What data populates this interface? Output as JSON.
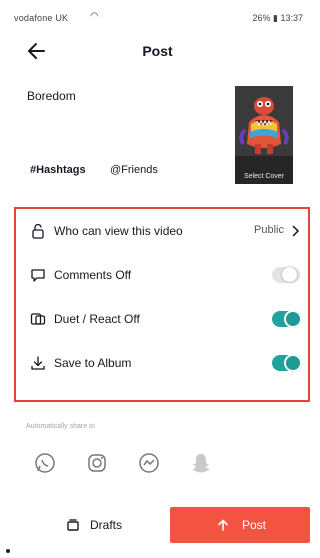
{
  "status_bar": {
    "carrier": "vodafone UK",
    "time": "13:37",
    "battery": "26%"
  },
  "header": {
    "title": "Post"
  },
  "post": {
    "caption": "Boredom",
    "cover_label": "Select Cover",
    "hashtags_label": "#Hashtags",
    "friends_label": "@Friends"
  },
  "settings": {
    "who_can_view_label": "Who can view this video",
    "who_can_view_value": "Public",
    "comments_label": "Comments Off",
    "comments_on": false,
    "duet_label": "Duet / React Off",
    "duet_on": true,
    "save_label": "Save to Album",
    "save_on": true
  },
  "share": {
    "label": "Automatically share to",
    "targets": [
      "whatsapp-icon",
      "instagram-icon",
      "facebook-messenger-icon",
      "snapchat-icon"
    ]
  },
  "actions": {
    "drafts_label": "Drafts",
    "post_label": "Post"
  },
  "colors": {
    "accent": "#f25441",
    "highlight_border": "#e8433a",
    "toggle_on": "#20a39e"
  }
}
